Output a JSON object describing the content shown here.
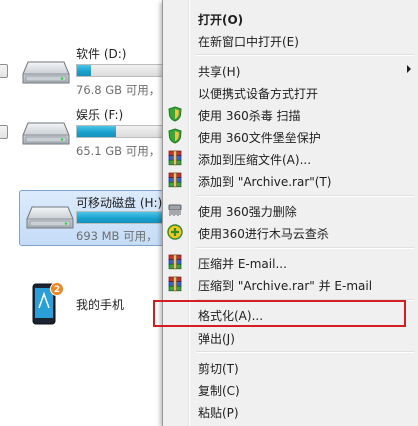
{
  "drives": [
    {
      "id": "d",
      "name": "软件 (D:)",
      "free": "76.8 GB 可用，",
      "used_fraction": 0.14
    },
    {
      "id": "f",
      "name": "娱乐 (F:)",
      "free": "65.1 GB 可用，",
      "used_fraction": 0.4
    },
    {
      "id": "h",
      "name": "可移动磁盘 (H:)",
      "free": "693 MB 可用，",
      "used_fraction": 0.92
    }
  ],
  "phone": {
    "name": "我的手机",
    "badge": "2"
  },
  "menu": {
    "open": "打开(O)",
    "open_new_window": "在新窗口中打开(E)",
    "share": "共享(H)",
    "open_portable": "以便携式设备方式打开",
    "scan_360": "使用 360杀毒 扫描",
    "protect_360": "使用 360文件堡垒保护",
    "add_archive": "添加到压缩文件(A)...",
    "add_archive_rar": "添加到 \"Archive.rar\"(T)",
    "delete_360": "使用 360强力删除",
    "trojan_360": "使用360进行木马云查杀",
    "compress_email": "压缩并 E-mail...",
    "compress_rar_email": "压缩到 \"Archive.rar\" 并 E-mail",
    "format": "格式化(A)...",
    "eject": "弹出(J)",
    "cut": "剪切(T)",
    "copy": "复制(C)",
    "paste": "粘贴(P)"
  },
  "colors": {
    "highlight": "#d51e24",
    "progress": "#1ba2cf"
  }
}
